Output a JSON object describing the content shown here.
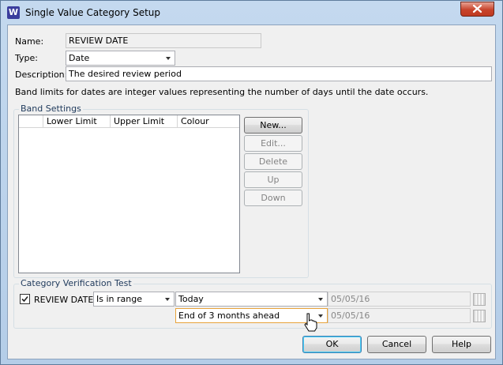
{
  "window": {
    "title": "Single Value Category Setup",
    "app_icon_letter": "W"
  },
  "form": {
    "name_label": "Name:",
    "name_value": "REVIEW DATE",
    "type_label": "Type:",
    "type_value": "Date",
    "description_label": "Description:",
    "description_value": "The desired review period",
    "info_text": "Band limits for dates are integer values representing the number of days until the date occurs."
  },
  "band_settings": {
    "title": "Band Settings",
    "columns": [
      "",
      "Lower Limit",
      "Upper Limit",
      "Colour"
    ],
    "buttons": {
      "new": "New...",
      "edit": "Edit...",
      "delete": "Delete",
      "up": "Up",
      "down": "Down"
    }
  },
  "verification": {
    "title": "Category Verification Test",
    "checkbox_label": "REVIEW DATE",
    "checked": true,
    "condition": "Is in range",
    "from_value": "Today",
    "from_date": "05/05/16",
    "to_value": "End of 3 months ahead",
    "to_date": "05/05/16"
  },
  "footer": {
    "ok": "OK",
    "cancel": "Cancel",
    "help": "Help"
  }
}
